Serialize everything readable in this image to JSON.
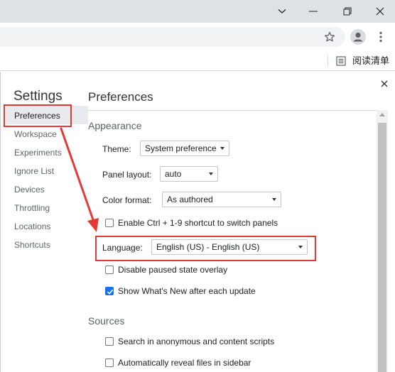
{
  "browser": {
    "reading_list_label": "阅读清单"
  },
  "devtools": {
    "settings_title": "Settings",
    "sidebar": {
      "items": [
        {
          "label": "Preferences",
          "selected": true
        },
        {
          "label": "Workspace"
        },
        {
          "label": "Experiments"
        },
        {
          "label": "Ignore List"
        },
        {
          "label": "Devices"
        },
        {
          "label": "Throttling"
        },
        {
          "label": "Locations"
        },
        {
          "label": "Shortcuts"
        }
      ]
    },
    "preferences": {
      "title": "Preferences",
      "appearance": {
        "section_title": "Appearance",
        "theme_label": "Theme:",
        "theme_value": "System preference",
        "panel_layout_label": "Panel layout:",
        "panel_layout_value": "auto",
        "color_format_label": "Color format:",
        "color_format_value": "As authored",
        "enable_shortcut_label": "Enable Ctrl + 1-9 shortcut to switch panels",
        "enable_shortcut_checked": false,
        "language_label": "Language:",
        "language_value": "English (US) - English (US)",
        "disable_paused_overlay_label": "Disable paused state overlay",
        "disable_paused_overlay_checked": false,
        "show_whats_new_label": "Show What's New after each update",
        "show_whats_new_checked": true
      },
      "sources": {
        "section_title": "Sources",
        "search_anonymous_label": "Search in anonymous and content scripts",
        "search_anonymous_checked": false,
        "reveal_files_label": "Automatically reveal files in sidebar",
        "reveal_files_checked": false
      }
    }
  },
  "colors": {
    "annotation": "#e53935",
    "checkbox_checked": "#1a73e8"
  }
}
